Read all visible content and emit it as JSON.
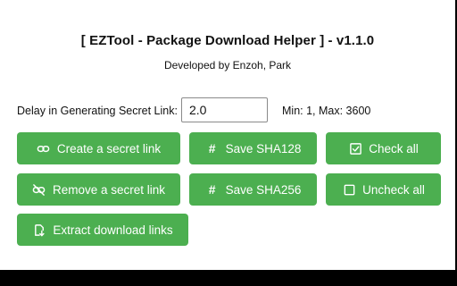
{
  "header": {
    "title": "[ EZTool - Package Download Helper ] - v1.1.0",
    "subtitle": "Developed by Enzoh, Park"
  },
  "settings": {
    "delay_label": "Delay in Generating Secret Link:",
    "delay_value": "2.0",
    "range_note": "Min: 1, Max: 3600"
  },
  "buttons": {
    "create_secret_link": "Create a secret link",
    "remove_secret_link": "Remove a secret link",
    "save_sha128": "Save SHA128",
    "save_sha256": "Save SHA256",
    "check_all": "Check all",
    "uncheck_all": "Uncheck all",
    "extract_download_links": "Extract download links"
  },
  "icons": {
    "create_secret_link": "link-icon",
    "remove_secret_link": "link-off-icon",
    "save_sha128": "hash-icon",
    "save_sha256": "hash-icon",
    "check_all": "checked-box-icon",
    "uncheck_all": "empty-box-icon",
    "extract_download_links": "download-file-icon"
  },
  "colors": {
    "button_bg": "#4caf50",
    "button_text": "#ffffff",
    "page_bg": "#ffffff",
    "frame": "#000000"
  }
}
